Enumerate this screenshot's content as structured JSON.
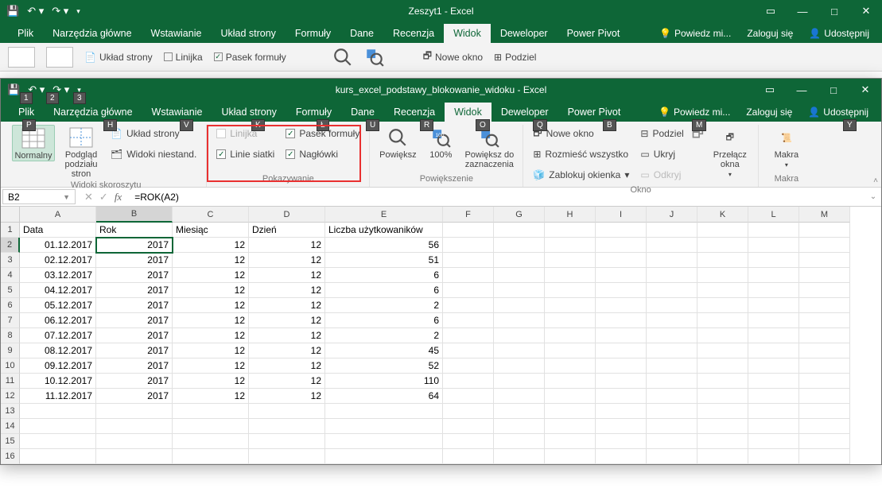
{
  "window1": {
    "title": "Zeszyt1 - Excel",
    "qat": {
      "save": "💾",
      "undo": "↶",
      "redo": "↷"
    },
    "tabs": [
      "Plik",
      "Narzędzia główne",
      "Wstawianie",
      "Układ strony",
      "Formuły",
      "Dane",
      "Recenzja",
      "Widok",
      "Deweloper",
      "Power Pivot"
    ],
    "active_tab": "Widok",
    "tell_me": "Powiedz mi...",
    "sign_in": "Zaloguj się",
    "share": "Udostępnij",
    "ribbon_items": {
      "layout": "Układ strony",
      "ruler": "Linijka",
      "formula_bar": "Pasek formuły",
      "new_window": "Nowe okno",
      "split": "Podziel"
    }
  },
  "window2": {
    "title": "kurs_excel_podstawy_blokowanie_widoku - Excel",
    "qat_badges": [
      "1",
      "2",
      "3"
    ],
    "tabs": [
      "Plik",
      "Narzędzia główne",
      "Wstawianie",
      "Układ strony",
      "Formuły",
      "Dane",
      "Recenzja",
      "Widok",
      "Deweloper",
      "Power Pivot"
    ],
    "active_tab": "Widok",
    "keytips": {
      "Plik": "P",
      "Narzędzia główne": "H",
      "Wstawianie": "V",
      "Układ strony": "K",
      "Formuły": "Ł",
      "Dane": "U",
      "Recenzja": "R",
      "Widok": "O",
      "Deweloper": "Q",
      "Power Pivot": "B",
      "Powiedz": "M",
      "Udostępnij": "Y"
    },
    "tell_me": "Powiedz mi...",
    "sign_in": "Zaloguj się",
    "share": "Udostępnij",
    "ribbon": {
      "views": {
        "label": "Widoki skoroszytu",
        "normal": "Normalny",
        "page_break": "Podgląd podziału stron",
        "page_layout": "Układ strony",
        "custom": "Widoki niestand."
      },
      "show": {
        "label": "Pokazywanie",
        "ruler": "Linijka",
        "formula_bar": "Pasek formuły",
        "gridlines": "Linie siatki",
        "headings": "Nagłówki"
      },
      "zoom": {
        "label": "Powiększenie",
        "zoom": "Powiększ",
        "p100": "100%",
        "zoom_sel": "Powiększ do zaznaczenia"
      },
      "window": {
        "label": "Okno",
        "new": "Nowe okno",
        "arrange": "Rozmieść wszystko",
        "freeze": "Zablokuj okienka",
        "split": "Podziel",
        "hide": "Ukryj",
        "unhide": "Odkryj",
        "switch": "Przełącz okna"
      },
      "macros": {
        "label": "Makra",
        "macros": "Makra"
      }
    },
    "namebox": "B2",
    "formula": "=ROK(A2)",
    "columns": [
      "A",
      "B",
      "C",
      "D",
      "E",
      "F",
      "G",
      "H",
      "I",
      "J",
      "K",
      "L",
      "M"
    ],
    "headers": {
      "A": "Data",
      "B": "Rok",
      "C": "Miesiąc",
      "D": "Dzień",
      "E": "Liczba użytkowaników"
    },
    "rows": [
      {
        "n": 2,
        "A": "01.12.2017",
        "B": "2017",
        "C": "12",
        "D": "12",
        "E": "56"
      },
      {
        "n": 3,
        "A": "02.12.2017",
        "B": "2017",
        "C": "12",
        "D": "12",
        "E": "51"
      },
      {
        "n": 4,
        "A": "03.12.2017",
        "B": "2017",
        "C": "12",
        "D": "12",
        "E": "6"
      },
      {
        "n": 5,
        "A": "04.12.2017",
        "B": "2017",
        "C": "12",
        "D": "12",
        "E": "6"
      },
      {
        "n": 6,
        "A": "05.12.2017",
        "B": "2017",
        "C": "12",
        "D": "12",
        "E": "2"
      },
      {
        "n": 7,
        "A": "06.12.2017",
        "B": "2017",
        "C": "12",
        "D": "12",
        "E": "6"
      },
      {
        "n": 8,
        "A": "07.12.2017",
        "B": "2017",
        "C": "12",
        "D": "12",
        "E": "2"
      },
      {
        "n": 9,
        "A": "08.12.2017",
        "B": "2017",
        "C": "12",
        "D": "12",
        "E": "45"
      },
      {
        "n": 10,
        "A": "09.12.2017",
        "B": "2017",
        "C": "12",
        "D": "12",
        "E": "52"
      },
      {
        "n": 11,
        "A": "10.12.2017",
        "B": "2017",
        "C": "12",
        "D": "12",
        "E": "110"
      },
      {
        "n": 12,
        "A": "11.12.2017",
        "B": "2017",
        "C": "12",
        "D": "12",
        "E": "64"
      }
    ],
    "empty_rows": [
      13,
      14,
      15,
      16
    ],
    "selected_cell": "B2"
  }
}
